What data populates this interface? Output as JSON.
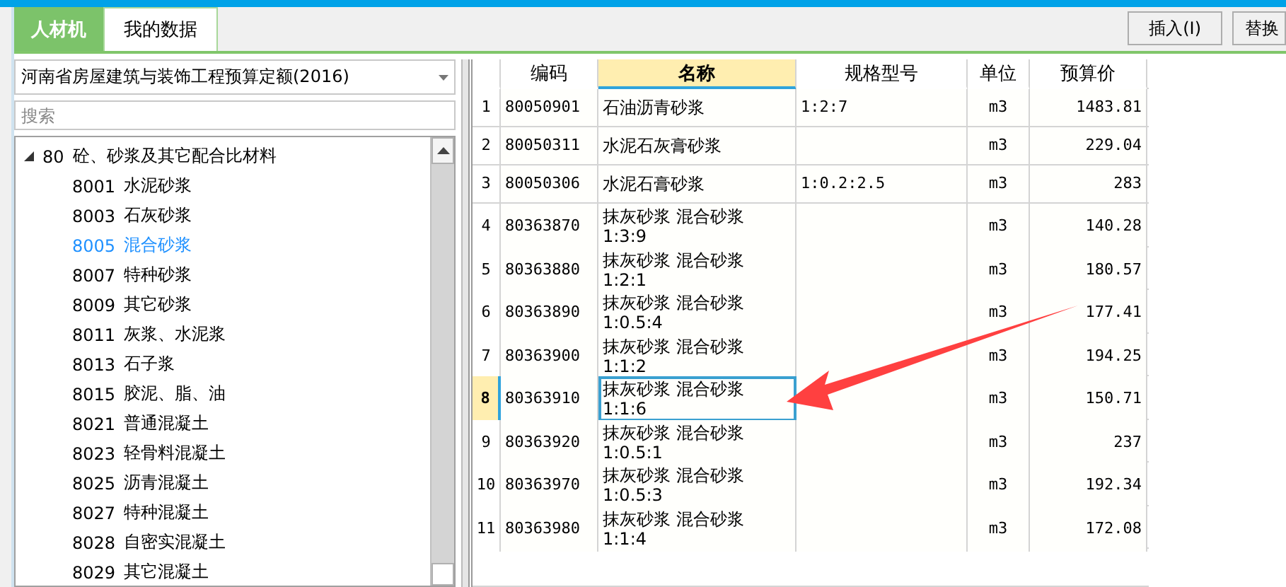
{
  "tabs": [
    {
      "label": "人材机",
      "selected": true
    },
    {
      "label": "我的数据",
      "selected": false
    }
  ],
  "toolbar_buttons": [
    "插入(I)",
    "替换"
  ],
  "library_select": {
    "value": "河南省房屋建筑与装饰工程预算定额(2016)"
  },
  "search": {
    "placeholder": "搜索"
  },
  "tree": [
    {
      "code": "80",
      "label": "砼、砂浆及其它配合比材料",
      "expanded": true,
      "children": [
        {
          "code": "8001",
          "label": "水泥砂浆",
          "selected": false
        },
        {
          "code": "8003",
          "label": "石灰砂浆",
          "selected": false
        },
        {
          "code": "8005",
          "label": "混合砂浆",
          "selected": true
        },
        {
          "code": "8007",
          "label": "特种砂浆",
          "selected": false
        },
        {
          "code": "8009",
          "label": "其它砂浆",
          "selected": false
        },
        {
          "code": "8011",
          "label": "灰浆、水泥浆",
          "selected": false
        },
        {
          "code": "8013",
          "label": "石子浆",
          "selected": false
        },
        {
          "code": "8015",
          "label": "胶泥、脂、油",
          "selected": false
        },
        {
          "code": "8021",
          "label": "普通混凝土",
          "selected": false
        },
        {
          "code": "8023",
          "label": "轻骨料混凝土",
          "selected": false
        },
        {
          "code": "8025",
          "label": "沥青混凝土",
          "selected": false
        },
        {
          "code": "8027",
          "label": "特种混凝土",
          "selected": false
        },
        {
          "code": "8028",
          "label": "自密实混凝土",
          "selected": false
        },
        {
          "code": "8029",
          "label": "其它混凝土",
          "selected": false
        }
      ]
    }
  ],
  "table": {
    "columns": [
      {
        "label": "编码",
        "selected": false
      },
      {
        "label": "名称",
        "selected": true
      },
      {
        "label": "规格型号",
        "selected": false
      },
      {
        "label": "单位",
        "selected": false
      },
      {
        "label": "预算价",
        "selected": false
      }
    ],
    "rows": [
      {
        "no": "1",
        "code": "80050901",
        "name": "石油沥青砂浆",
        "spec": "1:2:7",
        "unit": "m3",
        "price": "1483.81",
        "selected": false
      },
      {
        "no": "2",
        "code": "80050311",
        "name": "水泥石灰膏砂浆",
        "spec": "",
        "unit": "m3",
        "price": "229.04",
        "selected": false
      },
      {
        "no": "3",
        "code": "80050306",
        "name": "水泥石膏砂浆",
        "spec": "1:0.2:2.5",
        "unit": "m3",
        "price": "283",
        "selected": false
      },
      {
        "no": "4",
        "code": "80363870",
        "name": "抹灰砂浆 混合砂浆 1:3:9",
        "spec": "",
        "unit": "m3",
        "price": "140.28",
        "selected": false
      },
      {
        "no": "5",
        "code": "80363880",
        "name": "抹灰砂浆 混合砂浆 1:2:1",
        "spec": "",
        "unit": "m3",
        "price": "180.57",
        "selected": false
      },
      {
        "no": "6",
        "code": "80363890",
        "name": "抹灰砂浆 混合砂浆 1:0.5:4",
        "spec": "",
        "unit": "m3",
        "price": "177.41",
        "selected": false
      },
      {
        "no": "7",
        "code": "80363900",
        "name": "抹灰砂浆 混合砂浆 1:1:2",
        "spec": "",
        "unit": "m3",
        "price": "194.25",
        "selected": false
      },
      {
        "no": "8",
        "code": "80363910",
        "name": "抹灰砂浆 混合砂浆 1:1:6",
        "spec": "",
        "unit": "m3",
        "price": "150.71",
        "selected": true
      },
      {
        "no": "9",
        "code": "80363920",
        "name": "抹灰砂浆 混合砂浆 1:0.5:1",
        "spec": "",
        "unit": "m3",
        "price": "237",
        "selected": false
      },
      {
        "no": "10",
        "code": "80363970",
        "name": "抹灰砂浆 混合砂浆 1:0.5:3",
        "spec": "",
        "unit": "m3",
        "price": "192.34",
        "selected": false
      },
      {
        "no": "11",
        "code": "80363980",
        "name": "抹灰砂浆 混合砂浆 1:1:4",
        "spec": "",
        "unit": "m3",
        "price": "172.08",
        "selected": false
      }
    ]
  }
}
